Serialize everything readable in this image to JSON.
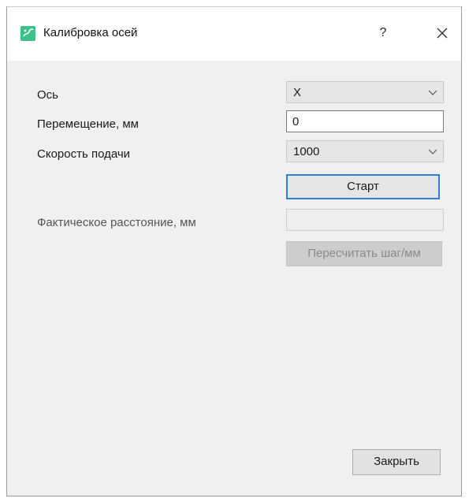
{
  "window": {
    "title": "Калибровка осей",
    "help_label": "?",
    "app_icon": "app-logo-icon",
    "close_icon": "close-icon"
  },
  "form": {
    "axis_label": "Ось",
    "axis_value": "X",
    "displacement_label": "Перемещение, мм",
    "displacement_value": "0",
    "feed_label": "Скорость подачи",
    "feed_value": "1000",
    "start_label": "Старт",
    "actual_label": "Фактическое расстояние, мм",
    "actual_value": "",
    "recalc_label": "Пересчитать шаг/мм"
  },
  "footer": {
    "close_label": "Закрыть"
  },
  "colors": {
    "dialog_bg": "#f0f0f0",
    "titlebar_bg": "#ffffff",
    "focus_border": "#2f7fd6",
    "icon_green": "#3fbf8a"
  }
}
